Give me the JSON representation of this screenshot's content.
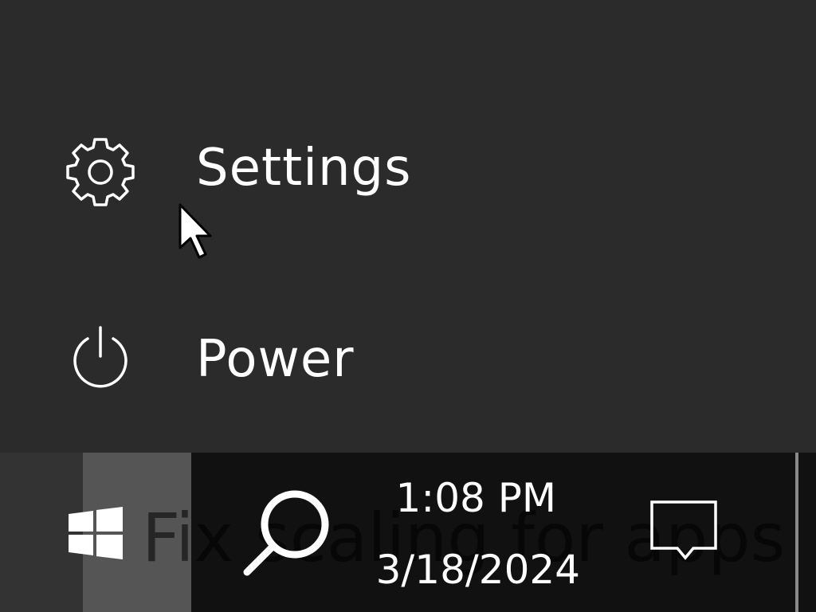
{
  "start_menu": {
    "items": [
      {
        "label": "Settings",
        "icon": "gear-icon"
      },
      {
        "label": "Power",
        "icon": "power-icon"
      }
    ]
  },
  "taskbar": {
    "start_icon": "windows-logo-icon",
    "search_icon": "search-icon",
    "overlay_text": "Fix scaling for apps",
    "clock": {
      "time": "1:08 PM",
      "date": "3/18/2024"
    },
    "notification_icon": "action-center-icon"
  },
  "colors": {
    "menu_bg": "#2b2b2b",
    "taskbar_bg": "#111111",
    "highlight": "#555555",
    "text": "#ffffff"
  }
}
